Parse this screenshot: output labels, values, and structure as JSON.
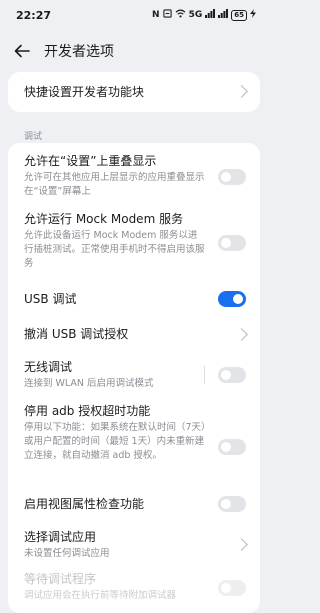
{
  "status_bar": {
    "time": "22:27",
    "network": "5G",
    "battery": "65"
  },
  "header": {
    "title": "开发者选项"
  },
  "top_card": {
    "quick_tiles_label": "快捷设置开发者功能块"
  },
  "section": {
    "debug_label": "调试"
  },
  "items": [
    {
      "title": "允许在“设置”上重叠显示",
      "desc": "允许可在其他应用上层显示的应用重叠显示在“设置”屏幕上",
      "toggle": false
    },
    {
      "title": "允许运行 Mock Modem 服务",
      "desc": "允许此设备运行 Mock Modem 服务以进行插桩测试。正常使用手机时不得启用该服务",
      "toggle": false
    },
    {
      "title": "USB 调试",
      "toggle": true
    },
    {
      "title": "撤消 USB 调试授权"
    },
    {
      "title": "无线调试",
      "desc": "连接到 WLAN 后启用调试模式",
      "toggle": false
    },
    {
      "title": "停用 adb 授权超时功能",
      "desc": "停用以下功能：如果系统在默认时间（7天）或用户配置的时间（最短 1天）内未重新建立连接，就自动撤消 adb 授权。",
      "toggle": false
    },
    {
      "title": "启用视图属性检查功能",
      "toggle": false
    },
    {
      "title": "选择调试应用",
      "desc": "未设置任何调试应用"
    },
    {
      "title": "等待调试程序",
      "desc": "调试应用会在执行前等待附加调试器",
      "toggle": false
    }
  ]
}
